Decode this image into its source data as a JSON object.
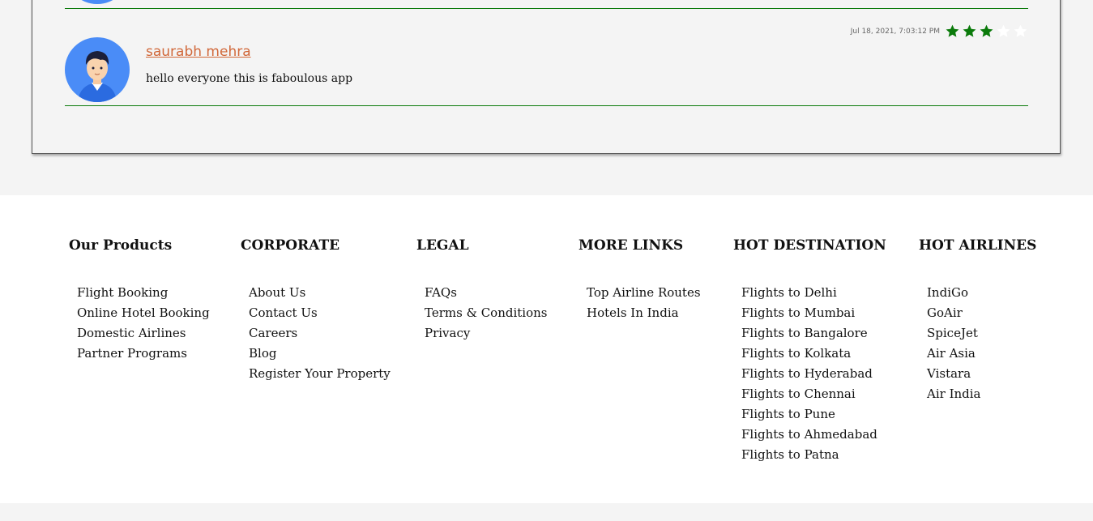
{
  "review": {
    "name": "saurabh mehra",
    "text": "hello everyone this is faboulous app",
    "date": "Jul 18, 2021, 7:03:12 PM",
    "rating": 3,
    "max_rating": 5,
    "star_color": "#0a7a0a",
    "star_empty_color": "#ffffff"
  },
  "footer": {
    "columns": [
      {
        "title": "Our Products",
        "links": [
          "Flight Booking",
          "Online Hotel Booking",
          "Domestic Airlines",
          "Partner Programs"
        ]
      },
      {
        "title": "CORPORATE",
        "links": [
          "About Us",
          "Contact Us",
          "Careers",
          "Blog",
          "Register Your Property"
        ]
      },
      {
        "title": "LEGAL",
        "links": [
          "FAQs",
          "Terms & Conditions",
          "Privacy"
        ]
      },
      {
        "title": "MORE LINKS",
        "links": [
          "Top Airline Routes",
          "Hotels In India"
        ]
      },
      {
        "title": "HOT DESTINATION",
        "links": [
          "Flights to Delhi",
          "Flights to Mumbai",
          "Flights to Bangalore",
          "Flights to Kolkata",
          "Flights to Hyderabad",
          "Flights to Chennai",
          "Flights to Pune",
          "Flights to Ahmedabad",
          "Flights to Patna"
        ]
      },
      {
        "title": "HOT AIRLINES",
        "links": [
          "IndiGo",
          "GoAir",
          "SpiceJet",
          "Air Asia",
          "Vistara",
          "Air India"
        ]
      }
    ]
  }
}
